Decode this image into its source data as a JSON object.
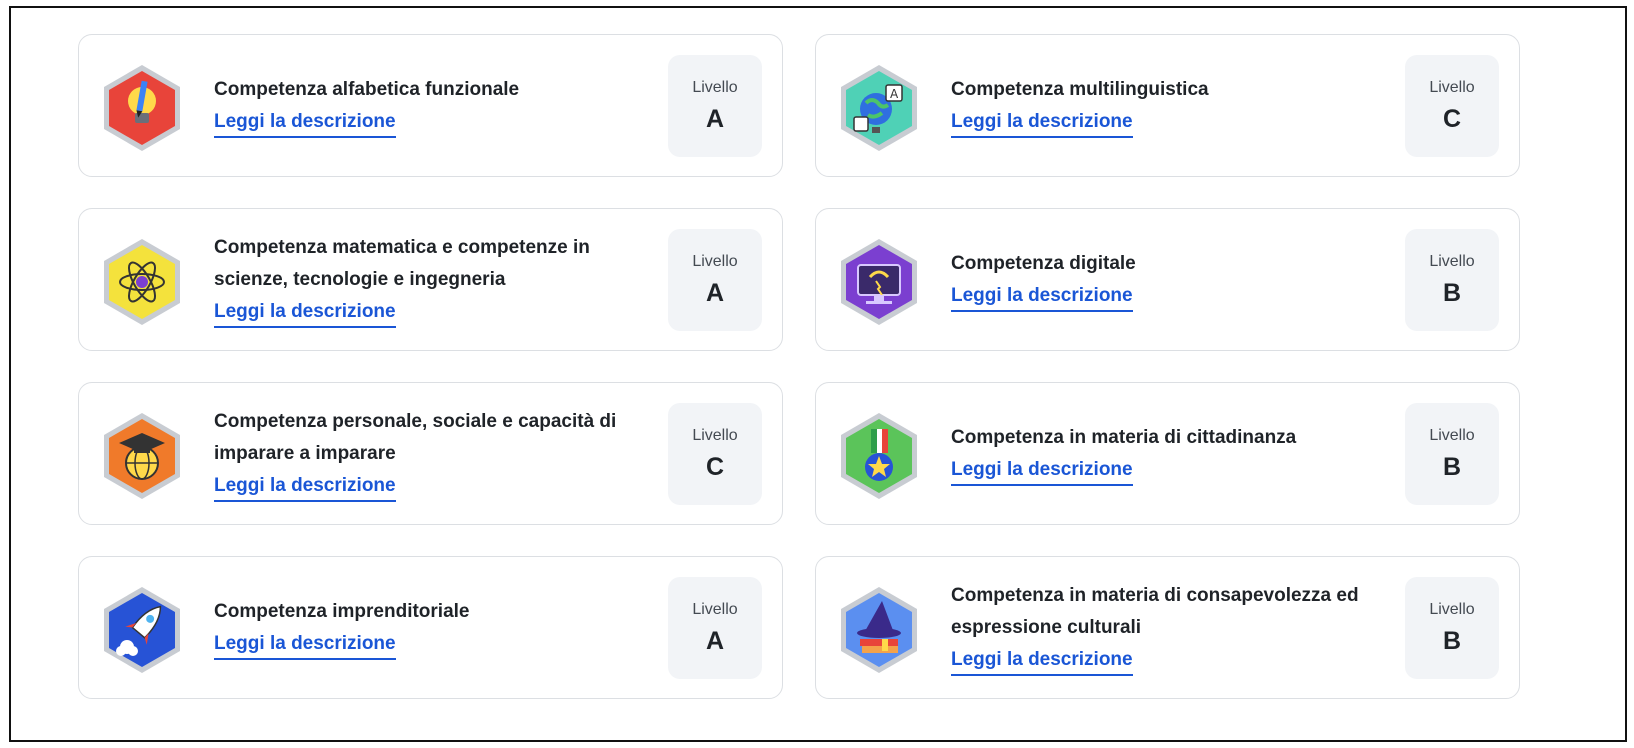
{
  "link_label": "Leggi la descrizione",
  "level_label": "Livello",
  "cards": [
    {
      "title": "Competenza alfabetica funzionale",
      "level": "A",
      "icon": "pencil-lightbulb-icon",
      "color": "#e8443a"
    },
    {
      "title": "Competenza multilinguistica",
      "level": "C",
      "icon": "globe-translation-icon",
      "color": "#4fd1b6"
    },
    {
      "title": "Competenza matematica e competenze in scienze, tecnologie e ingegneria",
      "level": "A",
      "icon": "atom-icon",
      "color": "#f4e23c"
    },
    {
      "title": "Competenza digitale",
      "level": "B",
      "icon": "digital-monitor-icon",
      "color": "#7b3fd0"
    },
    {
      "title": "Competenza personale, sociale e capacità di imparare a imparare",
      "level": "C",
      "icon": "graduation-globe-icon",
      "color": "#f07a2a"
    },
    {
      "title": "Competenza in materia di cittadinanza",
      "level": "B",
      "icon": "medal-star-icon",
      "color": "#5bc45a"
    },
    {
      "title": "Competenza imprenditoriale",
      "level": "A",
      "icon": "rocket-icon",
      "color": "#2753d6"
    },
    {
      "title": "Competenza in materia di consapevolezza ed espressione culturali",
      "level": "B",
      "icon": "wizard-hat-books-icon",
      "color": "#5b8ff0"
    }
  ]
}
